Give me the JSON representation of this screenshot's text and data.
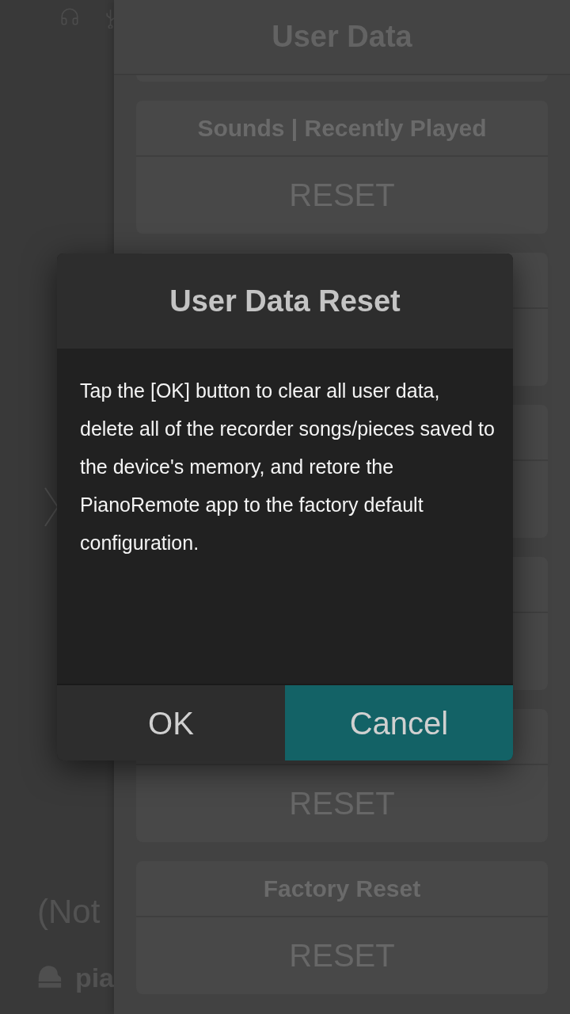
{
  "background_panel": {
    "status_text": "(Not",
    "device_name": "pia"
  },
  "page": {
    "title": "User Data",
    "cards": [
      {
        "kind": "titled",
        "title": "Sounds | Recently Played",
        "button": "RESET"
      },
      {
        "kind": "covered"
      },
      {
        "kind": "covered"
      },
      {
        "kind": "covered"
      },
      {
        "kind": "button_only",
        "button": "RESET"
      },
      {
        "kind": "titled",
        "title": "Factory Reset",
        "button": "RESET"
      }
    ]
  },
  "dialog": {
    "title": "User Data Reset",
    "message": "Tap the [OK] button to clear all user data, delete all of the recorder songs/pieces saved to the device's memory, and retore the PianoRemote app to the factory default configuration.",
    "buttons": [
      {
        "label": "OK",
        "selected": false
      },
      {
        "label": "Cancel",
        "selected": true
      }
    ]
  }
}
